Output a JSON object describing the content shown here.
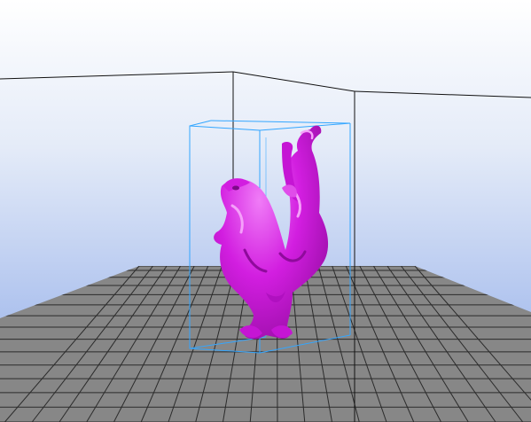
{
  "viewport": {
    "background_top": "#ffffff",
    "background_bottom": "#8ca9e8",
    "build_volume_color": "#111111",
    "bounding_box_color": "#33a6ff",
    "model_color": "#d21ee0",
    "model_highlight": "#f07cf7",
    "model_shadow": "#8f0a9c",
    "bed_color": "#878787",
    "bed_grid_color": "#2b2b2b"
  },
  "model": {
    "name_icon": "phoenix-model"
  }
}
